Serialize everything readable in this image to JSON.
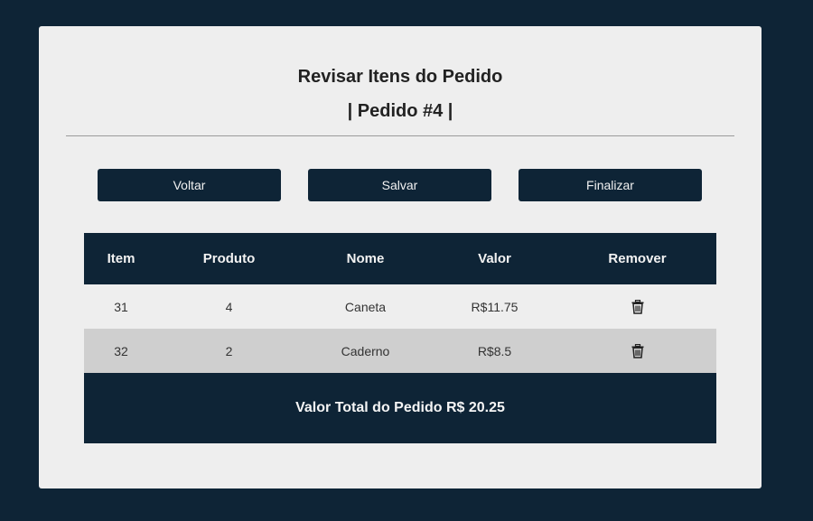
{
  "header": {
    "title": "Revisar Itens do Pedido",
    "subtitle": "| Pedido #4 |"
  },
  "actions": {
    "back_label": "Voltar",
    "save_label": "Salvar",
    "finish_label": "Finalizar"
  },
  "table": {
    "columns": [
      "Item",
      "Produto",
      "Nome",
      "Valor",
      "Remover"
    ],
    "rows": [
      {
        "item": "31",
        "produto": "4",
        "nome": "Caneta",
        "valor": "R$11.75",
        "remove_icon": "trash-icon"
      },
      {
        "item": "32",
        "produto": "2",
        "nome": "Caderno",
        "valor": "R$8.5",
        "remove_icon": "trash-icon"
      }
    ],
    "total_text": "Valor Total do Pedido R$ 20.25"
  },
  "colors": {
    "background": "#0e2436",
    "card": "#eeeeee",
    "accent": "#0e2436",
    "row_alt": "#cfcfcf"
  }
}
